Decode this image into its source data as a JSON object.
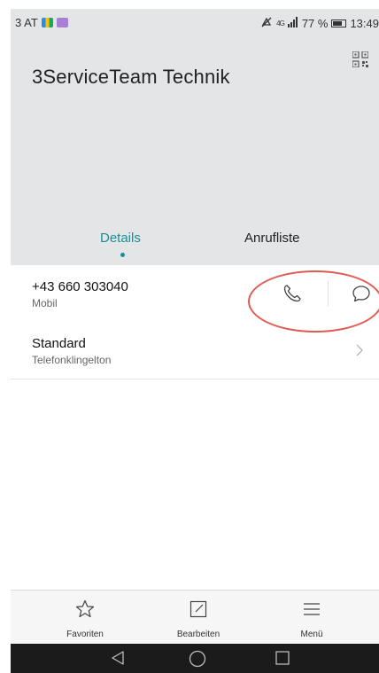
{
  "status_bar": {
    "carrier": "3 AT",
    "network": "4G",
    "battery": "77 %",
    "time": "13:49"
  },
  "contact": {
    "name": "3ServiceTeam Technik"
  },
  "tabs": [
    {
      "label": "Details",
      "active": true
    },
    {
      "label": "Anrufliste",
      "active": false
    }
  ],
  "phone_entry": {
    "number": "+43 660 303040",
    "type": "Mobil"
  },
  "ringtone_entry": {
    "title": "Standard",
    "subtitle": "Telefonklingelton"
  },
  "bottom_bar": {
    "favorites": "Favoriten",
    "edit": "Bearbeiten",
    "menu": "Menü"
  },
  "colors": {
    "accent": "#1a8f9a",
    "annotation": "#e25a4f",
    "header_bg": "#e4e5e7"
  }
}
